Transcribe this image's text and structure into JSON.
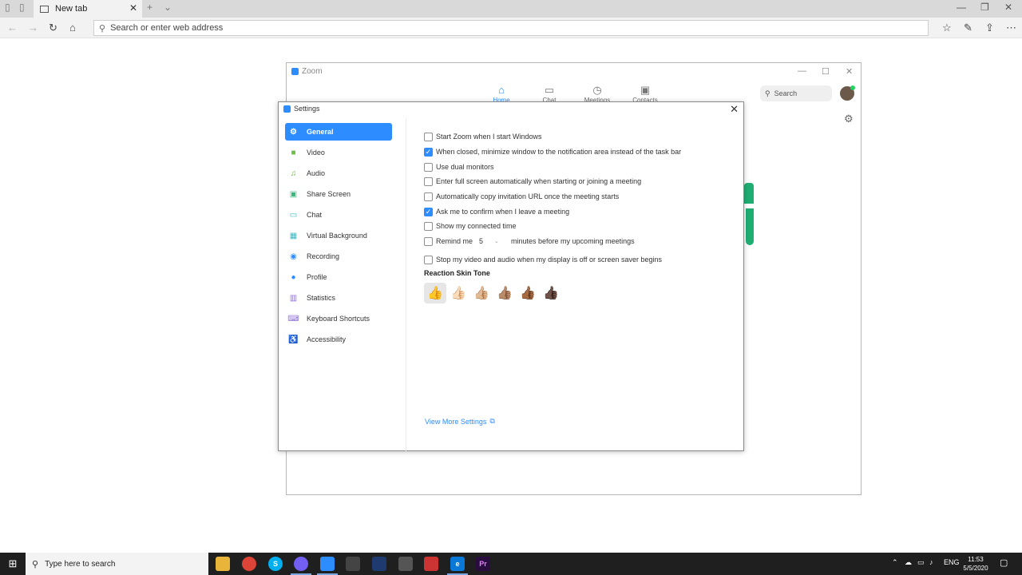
{
  "browser": {
    "tab_title": "New tab",
    "tab_close": "✕",
    "new_tab": "+",
    "tab_list": "⌄",
    "address_placeholder": "Search or enter web address",
    "win_min": "—",
    "win_max": "❐",
    "win_close": "✕"
  },
  "zoom": {
    "title": "Zoom",
    "nav": [
      {
        "label": "Home",
        "icon": "home-icon"
      },
      {
        "label": "Chat",
        "icon": "chat-icon"
      },
      {
        "label": "Meetings",
        "icon": "clock-icon"
      },
      {
        "label": "Contacts",
        "icon": "contacts-icon"
      }
    ],
    "search_label": "Search"
  },
  "settings": {
    "title": "Settings",
    "close": "✕",
    "sidebar": [
      {
        "label": "General",
        "icon": "gear-icon",
        "color": "#ffffff",
        "active": true
      },
      {
        "label": "Video",
        "icon": "video-icon",
        "color": "#6cc04a"
      },
      {
        "label": "Audio",
        "icon": "headphones-icon",
        "color": "#6cc04a"
      },
      {
        "label": "Share Screen",
        "icon": "share-screen-icon",
        "color": "#3bb77e"
      },
      {
        "label": "Chat",
        "icon": "chat-icon",
        "color": "#3bb7c4"
      },
      {
        "label": "Virtual Background",
        "icon": "person-icon",
        "color": "#3bb7c4"
      },
      {
        "label": "Recording",
        "icon": "recording-icon",
        "color": "#2d8cff"
      },
      {
        "label": "Profile",
        "icon": "profile-icon",
        "color": "#2d8cff"
      },
      {
        "label": "Statistics",
        "icon": "statistics-icon",
        "color": "#8c6cd8"
      },
      {
        "label": "Keyboard Shortcuts",
        "icon": "keyboard-icon",
        "color": "#8c6cd8"
      },
      {
        "label": "Accessibility",
        "icon": "accessibility-icon",
        "color": "#7a5fcf"
      }
    ],
    "options": [
      {
        "label": "Start Zoom when I start Windows",
        "checked": false
      },
      {
        "label": "When closed, minimize window to the notification area instead of the task bar",
        "checked": true
      },
      {
        "label": "Use dual monitors",
        "checked": false
      },
      {
        "label": "Enter full screen automatically when starting or joining a meeting",
        "checked": false
      },
      {
        "label": "Automatically copy invitation URL once the meeting starts",
        "checked": false
      },
      {
        "label": "Ask me to confirm when I leave a meeting",
        "checked": true
      },
      {
        "label": "Show my connected time",
        "checked": false
      }
    ],
    "remind": {
      "label_before": "Remind me",
      "value": "5",
      "label_after": "minutes before my upcoming meetings",
      "checked": false
    },
    "stop_video": {
      "label": "Stop my video and audio when my display is off or screen saver begins",
      "checked": false
    },
    "skin_tone_title": "Reaction Skin Tone",
    "skin_tones": [
      "👍",
      "👍🏻",
      "👍🏼",
      "👍🏽",
      "👍🏾",
      "👍🏿"
    ],
    "view_more": "View More Settings"
  },
  "taskbar": {
    "search_placeholder": "Type here to search",
    "language": "ENG",
    "time": "11:53",
    "date": "5/5/2020"
  }
}
